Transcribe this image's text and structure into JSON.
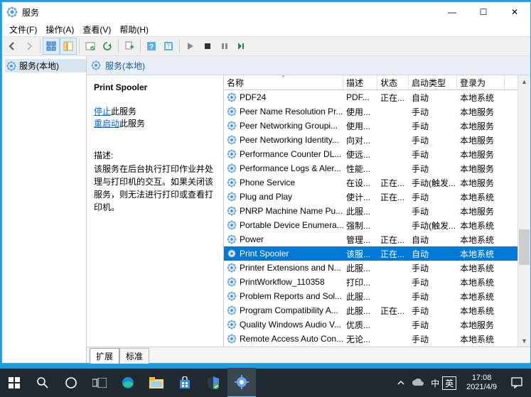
{
  "window": {
    "title": "服务",
    "menus": [
      "文件(F)",
      "操作(A)",
      "查看(V)",
      "帮助(H)"
    ]
  },
  "tree": {
    "root": "服务(本地)"
  },
  "right_header": "服务(本地)",
  "detail": {
    "service_name": "Print Spooler",
    "stop_link": "停止",
    "stop_suffix": "此服务",
    "restart_link": "重启动",
    "restart_suffix": "此服务",
    "desc_label": "描述:",
    "desc_text": "该服务在后台执行打印作业并处理与打印机的交互。如果关闭该服务，则无法进行打印或查看打印机。"
  },
  "columns": {
    "name": "名称",
    "desc": "描述",
    "status": "状态",
    "startup": "启动类型",
    "logon": "登录为"
  },
  "services": [
    {
      "name": "PDF24",
      "desc": "PDF...",
      "status": "正在...",
      "startup": "自动",
      "logon": "本地系统",
      "sel": false
    },
    {
      "name": "Peer Name Resolution Pr...",
      "desc": "使用...",
      "status": "",
      "startup": "手动",
      "logon": "本地服务",
      "sel": false
    },
    {
      "name": "Peer Networking Groupi...",
      "desc": "使用...",
      "status": "",
      "startup": "手动",
      "logon": "本地服务",
      "sel": false
    },
    {
      "name": "Peer Networking Identity...",
      "desc": "向对...",
      "status": "",
      "startup": "手动",
      "logon": "本地服务",
      "sel": false
    },
    {
      "name": "Performance Counter DL...",
      "desc": "使远...",
      "status": "",
      "startup": "手动",
      "logon": "本地服务",
      "sel": false
    },
    {
      "name": "Performance Logs & Aler...",
      "desc": "性能...",
      "status": "",
      "startup": "手动",
      "logon": "本地服务",
      "sel": false
    },
    {
      "name": "Phone Service",
      "desc": "在设...",
      "status": "正在...",
      "startup": "手动(触发...",
      "logon": "本地服务",
      "sel": false
    },
    {
      "name": "Plug and Play",
      "desc": "使计...",
      "status": "正在...",
      "startup": "手动",
      "logon": "本地系统",
      "sel": false
    },
    {
      "name": "PNRP Machine Name Pu...",
      "desc": "此服...",
      "status": "",
      "startup": "手动",
      "logon": "本地服务",
      "sel": false
    },
    {
      "name": "Portable Device Enumera...",
      "desc": "强制...",
      "status": "",
      "startup": "手动(触发...",
      "logon": "本地系统",
      "sel": false
    },
    {
      "name": "Power",
      "desc": "管理...",
      "status": "正在...",
      "startup": "自动",
      "logon": "本地系统",
      "sel": false
    },
    {
      "name": "Print Spooler",
      "desc": "该服...",
      "status": "正在...",
      "startup": "自动",
      "logon": "本地系统",
      "sel": true
    },
    {
      "name": "Printer Extensions and N...",
      "desc": "此服...",
      "status": "",
      "startup": "手动",
      "logon": "本地系统",
      "sel": false
    },
    {
      "name": "PrintWorkflow_110358",
      "desc": "打印...",
      "status": "",
      "startup": "手动",
      "logon": "本地系统",
      "sel": false
    },
    {
      "name": "Problem Reports and Sol...",
      "desc": "此服...",
      "status": "",
      "startup": "手动",
      "logon": "本地系统",
      "sel": false
    },
    {
      "name": "Program Compatibility A...",
      "desc": "此服...",
      "status": "正在...",
      "startup": "手动",
      "logon": "本地系统",
      "sel": false
    },
    {
      "name": "Quality Windows Audio V...",
      "desc": "优质...",
      "status": "",
      "startup": "手动",
      "logon": "本地服务",
      "sel": false
    },
    {
      "name": "Remote Access Auto Con...",
      "desc": "无论...",
      "status": "",
      "startup": "手动",
      "logon": "本地系统",
      "sel": false
    }
  ],
  "tabs": {
    "extended": "扩展",
    "standard": "标准"
  },
  "taskbar": {
    "ime_region": "中",
    "ime_lang": "英",
    "time": "17:08",
    "date": "2021/4/9"
  }
}
